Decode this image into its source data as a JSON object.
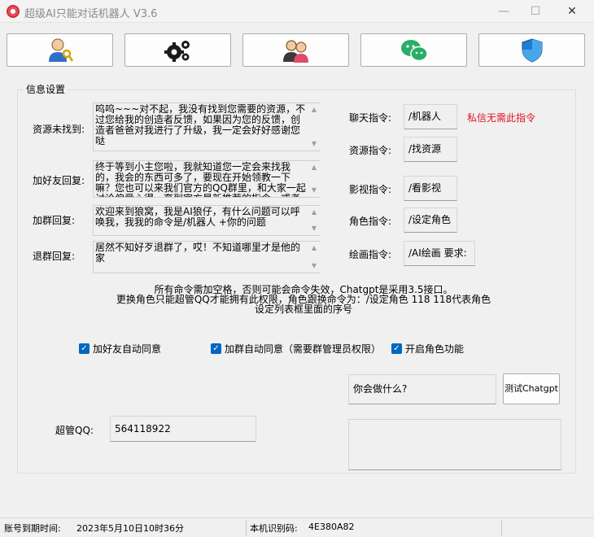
{
  "window": {
    "title": "超级AI只能对话机器人 V3.6",
    "minimize": "—",
    "maximize": "☐",
    "close": "✕"
  },
  "toolbar": {
    "buttons": [
      {
        "icon": "user-key-icon"
      },
      {
        "icon": "gears-icon"
      },
      {
        "icon": "users-icon"
      },
      {
        "icon": "wechat-icon"
      },
      {
        "icon": "shield-icon"
      }
    ]
  },
  "settings": {
    "group_title": "信息设置",
    "replies": [
      {
        "label": "资源未找到:",
        "text": "呜呜~~~对不起，我没有找到您需要的资源，不过您给我的创造者反馈，如果因为您的反馈，创造者爸爸对我进行了升级，我一定会好好感谢您哒"
      },
      {
        "label": "加好友回复:",
        "text": "终于等到小主您啦，我就知道您一定会来找我的，我会的东西可多了，要现在开始领教一下嘛？您也可以来我们官方的QQ群里，和大家一起讨论偏爱心得，奎到官方最新推荐的指令，或者提出"
      },
      {
        "label": "加群回复:",
        "text": "欢迎来到狼窝，我是AI狼仔，有什么问题可以呼唤我，我我的命令是/机器人 +你的问题"
      },
      {
        "label": "退群回复:",
        "text": "居然不知好歹退群了，哎！不知道哪里才是他的家"
      }
    ],
    "commands": [
      {
        "label": "聊天指令:",
        "value": "/机器人"
      },
      {
        "label": "资源指令:",
        "value": "/找资源"
      },
      {
        "label": "影视指令:",
        "value": "/看影视"
      },
      {
        "label": "角色指令:",
        "value": "/设定角色"
      },
      {
        "label": "绘画指令:",
        "value": "/AI绘画 要求:"
      }
    ],
    "private_note": "私信无需此指令",
    "notes": [
      "所有命令需加空格，否则可能会命令失效，Chatgpt是采用3.5接口。",
      "更换角色只能超管QQ才能拥有此权限，角色跟换命令为：/设定角色 118  118代表角色",
      "设定列表框里面的序号"
    ],
    "checkboxes": [
      {
        "label": "加好友自动同意",
        "checked": true
      },
      {
        "label": "加群自动同意（需要群管理员权限）",
        "checked": true
      },
      {
        "label": "开启角色功能",
        "checked": true
      }
    ],
    "test_input": "你会做什么?",
    "test_button": "测试Chatgpt",
    "test_output": "",
    "admin_label": "超管QQ:",
    "admin_qq": "564118922"
  },
  "status": {
    "expire_label": "账号到期时间:",
    "expire_value": "2023年5月10日10时36分",
    "machine_label": "本机识别码:",
    "machine_value": "4E380A82"
  },
  "colors": {
    "accent": "#0067c0",
    "warning": "#e0141e"
  }
}
